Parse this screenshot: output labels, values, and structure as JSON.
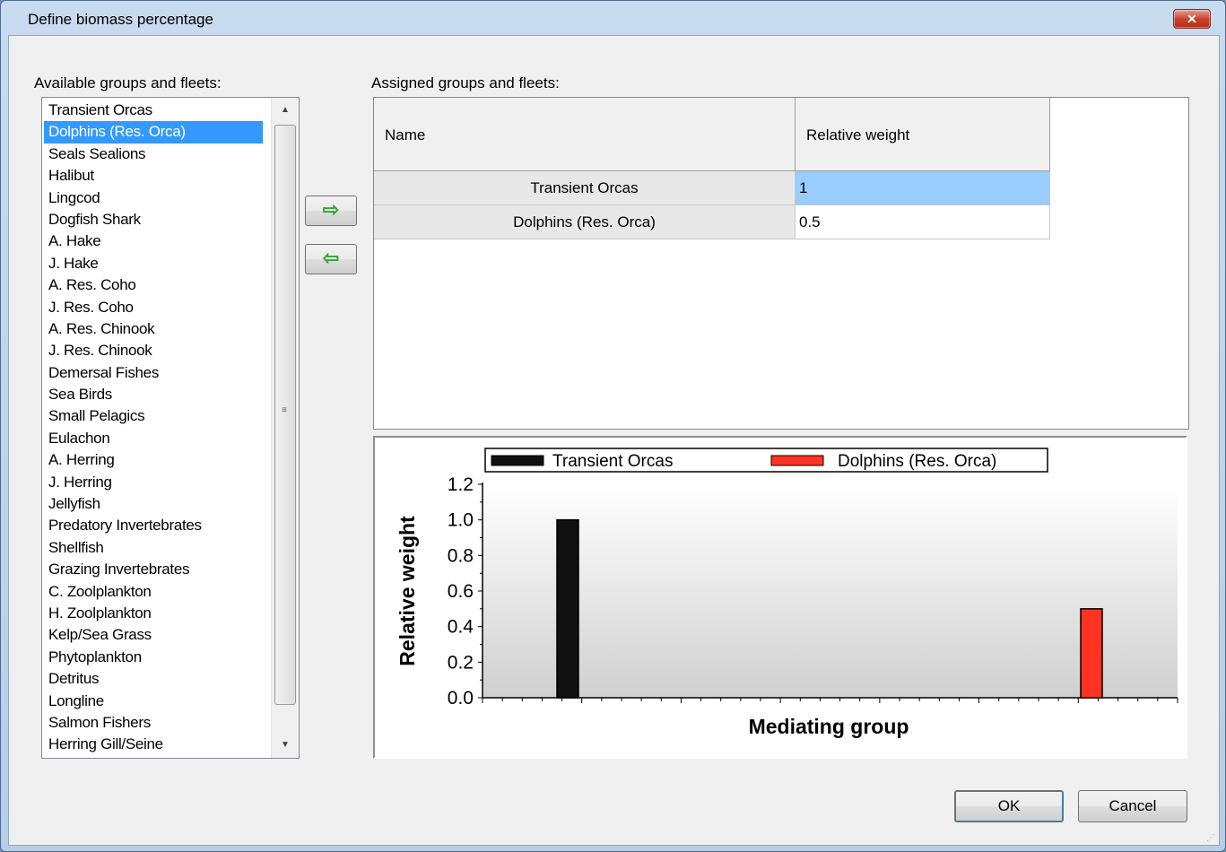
{
  "window": {
    "title": "Define biomass percentage",
    "close_glyph": "✕"
  },
  "available": {
    "label": "Available groups and fleets:",
    "selected_index": 1,
    "items": [
      "Transient Orcas",
      "Dolphins (Res. Orca)",
      "Seals Sealions",
      "Halibut",
      "Lingcod",
      "Dogfish Shark",
      "A. Hake",
      "J. Hake",
      "A. Res. Coho",
      "J. Res. Coho",
      "A. Res. Chinook",
      "J. Res. Chinook",
      "Demersal Fishes",
      "Sea Birds",
      "Small Pelagics",
      "Eulachon",
      "A. Herring",
      "J. Herring",
      "Jellyfish",
      "Predatory Invertebrates",
      "Shellfish",
      "Grazing Invertebrates",
      "C. Zoolplankton",
      "H. Zoolplankton",
      "Kelp/Sea Grass",
      "Phytoplankton",
      "Detritus",
      "Longline",
      "Salmon Fishers",
      "Herring Gill/Seine"
    ]
  },
  "move_buttons": {
    "add_glyph": "⇨",
    "remove_glyph": "⇦"
  },
  "assigned": {
    "label": "Assigned groups and fleets:",
    "columns": [
      "Name",
      "Relative weight"
    ],
    "rows": [
      {
        "name": "Transient Orcas",
        "weight": "1"
      },
      {
        "name": "Dolphins (Res. Orca)",
        "weight": "0.5"
      }
    ]
  },
  "chart_data": {
    "type": "bar",
    "categories": [
      "Transient Orcas",
      "Dolphins (Res. Orca)"
    ],
    "series": [
      {
        "name": "Transient Orcas",
        "values": [
          1.0,
          null
        ],
        "color": "#111111"
      },
      {
        "name": "Dolphins (Res. Orca)",
        "values": [
          null,
          0.5
        ],
        "color": "#ff3322"
      }
    ],
    "title": "",
    "xlabel": "Mediating group",
    "ylabel": "Relative weight",
    "ylim": [
      0,
      1.2
    ],
    "yticks": [
      "0.0",
      "0.2",
      "0.4",
      "0.6",
      "0.8",
      "1.0",
      "1.2"
    ],
    "legend": "top",
    "grid": false
  },
  "footer": {
    "ok_label": "OK",
    "cancel_label": "Cancel"
  }
}
